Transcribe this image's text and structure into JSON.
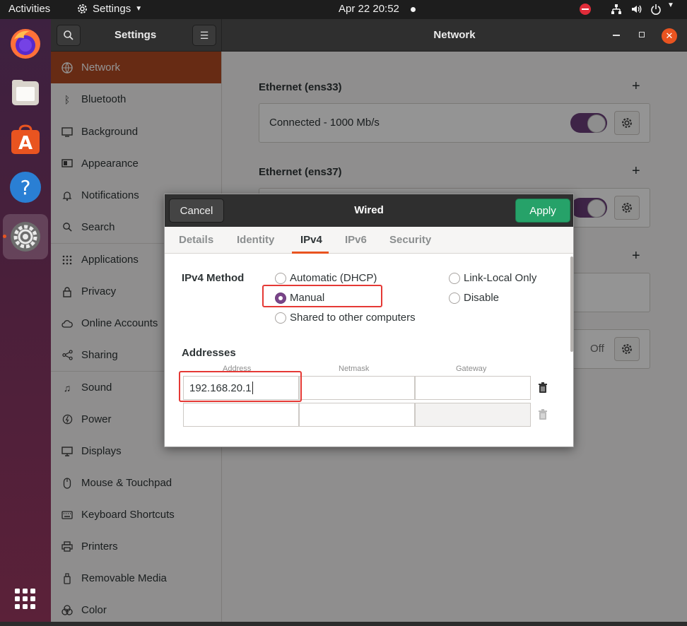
{
  "topbar": {
    "activities": "Activities",
    "app_menu": "Settings",
    "clock": "Apr 22  20:52"
  },
  "window": {
    "sidebar_title": "Settings",
    "pane_title": "Network"
  },
  "sidebar": {
    "items": [
      {
        "label": "Network",
        "icon": "network-icon"
      },
      {
        "label": "Bluetooth",
        "icon": "bluetooth-icon"
      },
      {
        "label": "Background",
        "icon": "background-icon"
      },
      {
        "label": "Appearance",
        "icon": "appearance-icon"
      },
      {
        "label": "Notifications",
        "icon": "bell-icon"
      },
      {
        "label": "Search",
        "icon": "search-icon"
      },
      {
        "label": "Applications",
        "icon": "grid-icon"
      },
      {
        "label": "Privacy",
        "icon": "lock-icon"
      },
      {
        "label": "Online Accounts",
        "icon": "cloud-icon"
      },
      {
        "label": "Sharing",
        "icon": "share-icon"
      },
      {
        "label": "Sound",
        "icon": "music-icon"
      },
      {
        "label": "Power",
        "icon": "power-icon"
      },
      {
        "label": "Displays",
        "icon": "display-icon"
      },
      {
        "label": "Mouse & Touchpad",
        "icon": "mouse-icon"
      },
      {
        "label": "Keyboard Shortcuts",
        "icon": "keyboard-icon"
      },
      {
        "label": "Printers",
        "icon": "printer-icon"
      },
      {
        "label": "Removable Media",
        "icon": "media-icon"
      },
      {
        "label": "Color",
        "icon": "color-icon"
      }
    ]
  },
  "network": {
    "eth1_title": "Ethernet (ens33)",
    "eth1_status": "Connected - 1000 Mb/s",
    "eth2_title": "Ethernet (ens37)",
    "vpn_off": "Off"
  },
  "dialog": {
    "cancel": "Cancel",
    "title": "Wired",
    "apply": "Apply",
    "tabs": [
      "Details",
      "Identity",
      "IPv4",
      "IPv6",
      "Security"
    ],
    "active_tab": "IPv4",
    "method_label": "IPv4 Method",
    "methods": {
      "auto": "Automatic (DHCP)",
      "manual": "Manual",
      "shared": "Shared to other computers",
      "link_local": "Link-Local Only",
      "disable": "Disable"
    },
    "selected_method": "Manual",
    "addresses_label": "Addresses",
    "col_address": "Address",
    "col_netmask": "Netmask",
    "col_gateway": "Gateway",
    "row1_address": "192.168.20.1",
    "row1_netmask": "",
    "row1_gateway": ""
  },
  "colors": {
    "accent": "#e95420",
    "selected_sidebar": "#b14a23",
    "apply_green": "#26a269",
    "toggle_purple": "#6b3f7a",
    "highlight_red": "#e53935"
  }
}
